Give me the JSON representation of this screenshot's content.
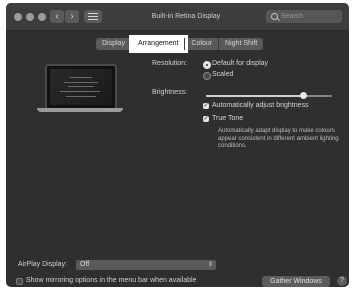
{
  "window": {
    "title": "Built-in Retina Display"
  },
  "toolbar": {
    "back_glyph": "‹",
    "forward_glyph": "›",
    "grid_icon": "grid-icon",
    "search_placeholder": "Search"
  },
  "tabs": [
    {
      "label": "Display",
      "active": false
    },
    {
      "label": "Arrangement",
      "active": true
    },
    {
      "label": "Colour",
      "active": false
    },
    {
      "label": "Night Shift",
      "active": false
    }
  ],
  "resolution": {
    "label": "Resolution:",
    "options": [
      "Default for display",
      "Scaled"
    ],
    "selected": "Default for display"
  },
  "brightness": {
    "label": "Brightness:",
    "level_fraction": 0.77
  },
  "auto_brightness": {
    "label": "Automatically adjust brightness",
    "checked": true
  },
  "true_tone": {
    "label": "True Tone",
    "checked": true,
    "description": "Automatically adapt display to make colours appear consistent in different ambient lighting conditions."
  },
  "airplay": {
    "label": "AirPlay Display:",
    "value": "Off"
  },
  "mirroring": {
    "label": "Show mirroring options in the menu bar when available",
    "checked": false
  },
  "gather_windows": {
    "label": "Gather Windows"
  },
  "help": {
    "label": "?"
  },
  "colors": {
    "window_bg": "#2f2f2f",
    "titlebar_bg": "#3d3d3d",
    "highlight": "#ffffff"
  }
}
